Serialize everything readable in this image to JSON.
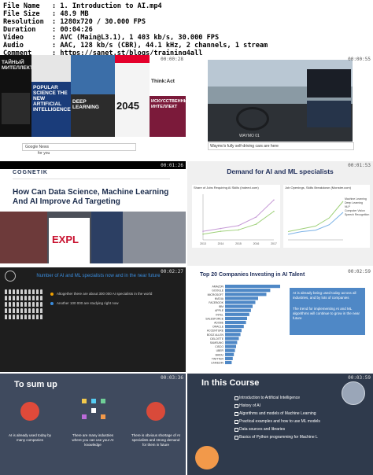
{
  "info": {
    "rows": [
      {
        "key": "File Name",
        "value": ": 1. Introduction to AI.mp4"
      },
      {
        "key": "File Size",
        "value": ": 48.9 MB"
      },
      {
        "key": "Resolution",
        "value": ": 1280x720 / 30.000 FPS"
      },
      {
        "key": "Duration",
        "value": ": 00:04:26"
      },
      {
        "key": "Video",
        "value": ": AVC (Main@L3.1), 1 403 kb/s, 30.000 FPS"
      },
      {
        "key": "Audio",
        "value": ": AAC, 128 kb/s (CBR), 44.1 kHz, 2 channels, 1 stream"
      },
      {
        "key": "Comment",
        "value": ": https://sanet.st/blogs/training4all"
      }
    ]
  },
  "thumbs": [
    {
      "time": "00:00:28",
      "covers": [
        "ТАЙНЫЙ МИТЕЛЛЕКТ",
        "POPULAR SCIENCE THE NEW ARTIFICIAL INTELLIGENCE",
        "DEEP LEARNING",
        "2045",
        "Think:Act",
        "ИСКУССТВЕННЫЙ ИНТЕЛЛЕКТ"
      ],
      "search_brand": "Google News",
      "search_item": "for you"
    },
    {
      "time": "00:00:55",
      "caption": "Waymo's fully self-driving cars are here",
      "dash_text": "WAYMO 01"
    },
    {
      "time": "00:01:26",
      "brand": "COGNETIK",
      "headline": "How Can Data Science, Machine Learning And AI Improve Ad Targeting",
      "times_sq": "EXPL"
    },
    {
      "time": "00:01:53",
      "title": "Demand for AI and ML specialists",
      "left_chart_title": "Share of Jobs Requiring AI Skills (Indeed.com)",
      "right_chart_title": "Job Openings, Skills Breakdown (Monster.com)",
      "legend": [
        "Machine Learning",
        "Deep Learning",
        "NLP",
        "Computer Vision",
        "Speech Recognition"
      ],
      "years": [
        "2013",
        "2014",
        "2015",
        "2016",
        "2017"
      ],
      "series": [
        {
          "name": "Indeed",
          "values": [
            0.3,
            0.4,
            0.5,
            0.8,
            1.4
          ]
        },
        {
          "name": "Monster",
          "values": [
            0.2,
            0.3,
            0.35,
            0.55,
            1.0
          ]
        }
      ],
      "colors": {
        "a": "#c69ad6",
        "b": "#9fd07a",
        "c": "#7ab1e6"
      }
    },
    {
      "time": "00:02:27",
      "headline": "Number of AI and ML specialists now and in the near future",
      "line1": "Altogether there are about 300 000 AI specialists in the world",
      "line2": "Another 100 000 are studying right now"
    },
    {
      "time": "00:02:59",
      "title": "Top 20 Companies Investing in AI Talent",
      "companies": [
        "AMAZON",
        "GOOGLE",
        "MICROSOFT",
        "NVIDIA",
        "FACEBOOK",
        "IBM",
        "APPLE",
        "INTEL",
        "SALESFORCE",
        "ADOBE",
        "ORACLE",
        "ACCENTURE",
        "BOOZ ALLEN",
        "DELOITTE",
        "SAMSUNG",
        "CISCO",
        "UBER",
        "BAIDU",
        "TWITTER",
        "LINKEDIN"
      ],
      "values": [
        100,
        82,
        75,
        60,
        55,
        50,
        47,
        44,
        40,
        38,
        34,
        30,
        28,
        25,
        22,
        20,
        18,
        16,
        14,
        12
      ],
      "bullet1": "AI is already being used today across all industries, and by lots of companies",
      "bullet2": "The trend for implementing AI and ML algorithms will continue to grow in the near future"
    },
    {
      "time": "00:03:36",
      "title": "To sum up",
      "cap1": "AI is already used today by many companies",
      "cap2": "There are many industries where you can use your AI knowledge",
      "cap3": "There is obvious shortage of AI specialists and strong demand for them in future"
    },
    {
      "time": "00:03:59",
      "title": "In this Course",
      "items": [
        "Introduction to Artificial Intelligence",
        "History of AI",
        "Algorithms and models of Machine Learning",
        "Practical examples and how to use ML models",
        "Data sources and libraries",
        "Basics of Python programming for Machine L"
      ]
    }
  ]
}
